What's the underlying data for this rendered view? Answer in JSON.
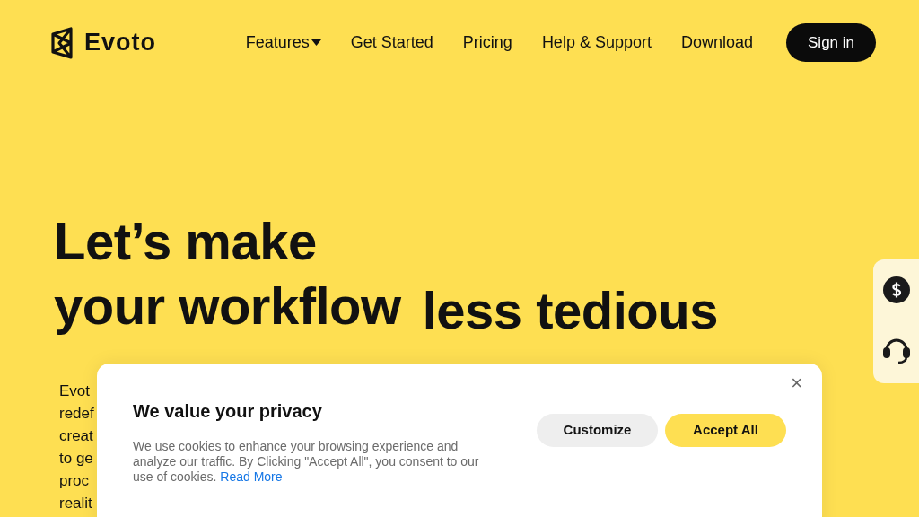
{
  "nav": {
    "brand": "Evoto",
    "items": [
      {
        "label": "Features",
        "dropdown": true
      },
      {
        "label": "Get Started",
        "dropdown": false
      },
      {
        "label": "Pricing",
        "dropdown": false
      },
      {
        "label": "Help & Support",
        "dropdown": false
      },
      {
        "label": "Download",
        "dropdown": false
      }
    ],
    "signin": "Sign in"
  },
  "hero": {
    "line1": "Let’s make",
    "line2a": "your workflow",
    "line2b": "less tedious",
    "body_fragments": [
      "Evot",
      "redef",
      "creat",
      "to ge",
      "proc",
      "realit"
    ]
  },
  "cookie": {
    "close": "×",
    "title": "We value your privacy",
    "text": "We use cookies to enhance your browsing experience and analyze our traffic. By Clicking \"Accept All\", you consent to our use of cookies.",
    "link": "Read More",
    "buttons": [
      {
        "label": "Customize",
        "kind": "secondary"
      },
      {
        "label": "Accept All",
        "kind": "primary"
      }
    ]
  }
}
